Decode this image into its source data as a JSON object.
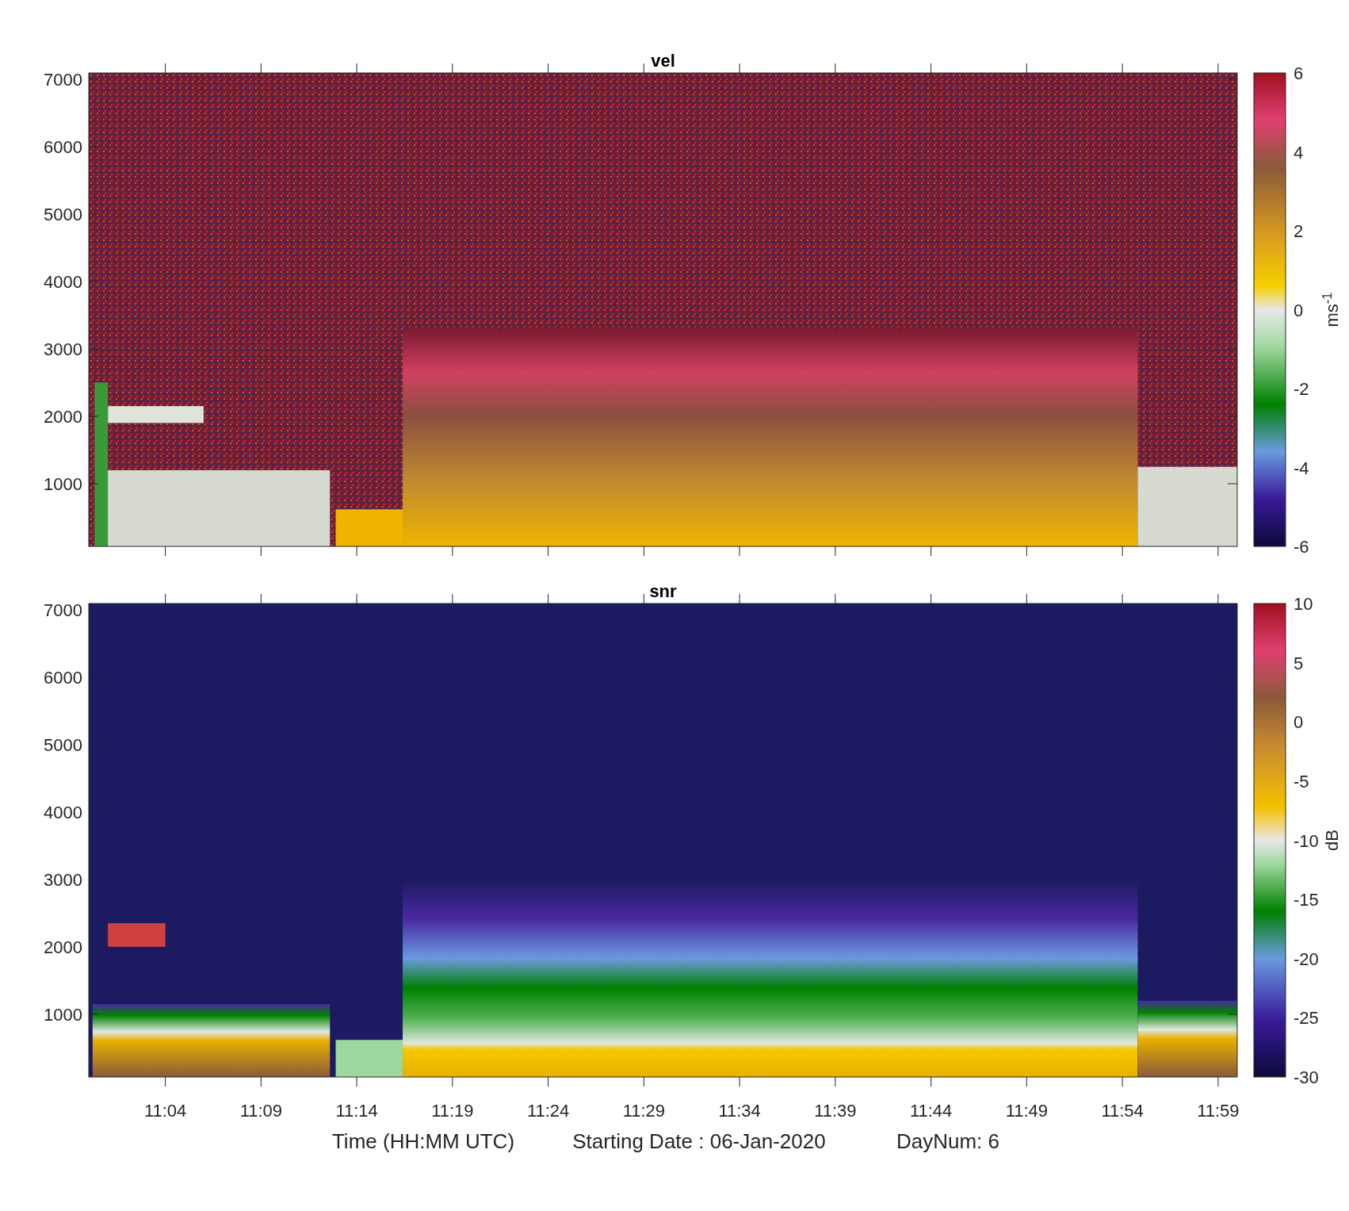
{
  "panels": [
    {
      "title": "vel",
      "kind": "velocity",
      "yticks": [
        "7000",
        "6000",
        "5000",
        "4000",
        "3000",
        "2000",
        "1000"
      ],
      "colorbar": {
        "ticks": [
          "6",
          "4",
          "2",
          "0",
          "-2",
          "-4",
          "-6"
        ],
        "label": "ms$^{-1}$"
      }
    },
    {
      "title": "snr",
      "kind": "snr",
      "yticks": [
        "7000",
        "6000",
        "5000",
        "4000",
        "3000",
        "2000",
        "1000"
      ],
      "xticks": [
        "11:04",
        "11:09",
        "11:14",
        "11:19",
        "11:24",
        "11:29",
        "11:34",
        "11:39",
        "11:44",
        "11:49",
        "11:54",
        "11:59"
      ],
      "colorbar": {
        "ticks": [
          "10",
          "5",
          "0",
          "-5",
          "-10",
          "-15",
          "-20",
          "-25",
          "-30"
        ],
        "label": "dB"
      }
    }
  ],
  "xlabel": [
    "Time (HH:MM UTC)",
    "Starting Date : 06-Jan-2020",
    "DayNum: 6"
  ]
}
